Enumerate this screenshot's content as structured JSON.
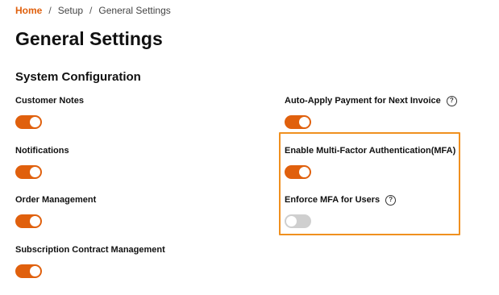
{
  "breadcrumb": {
    "home": "Home",
    "separator": "/",
    "setup": "Setup",
    "current": "General Settings"
  },
  "page_title": "General Settings",
  "section_title": "System Configuration",
  "colors": {
    "accent": "#e0600d",
    "highlight": "#f0901f",
    "toggle_off": "#cfcfcf"
  },
  "settings": {
    "customer_notes": {
      "label": "Customer Notes",
      "enabled": true
    },
    "notifications": {
      "label": "Notifications",
      "enabled": true
    },
    "order_management": {
      "label": "Order Management",
      "enabled": true
    },
    "subscription_contract_management": {
      "label": "Subscription Contract Management",
      "enabled": true
    },
    "auto_apply_payment": {
      "label": "Auto-Apply Payment for Next Invoice",
      "enabled": true,
      "help_icon": "question-circle-icon"
    },
    "enable_mfa": {
      "label": "Enable Multi-Factor Authentication(MFA)",
      "enabled": true
    },
    "enforce_mfa": {
      "label": "Enforce MFA for Users",
      "enabled": false,
      "help_icon": "question-circle-icon"
    }
  },
  "help_glyph": "?"
}
